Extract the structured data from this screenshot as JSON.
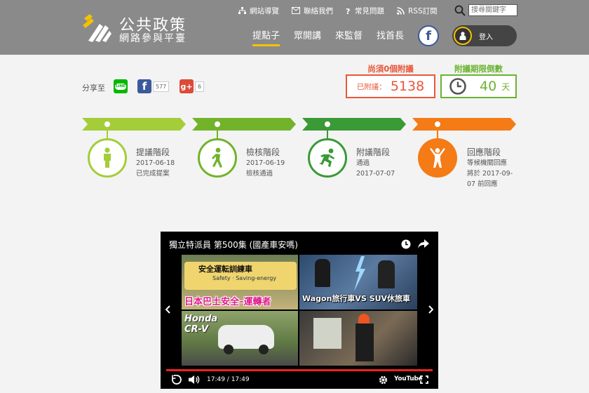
{
  "header": {
    "logo_title": "公共政策",
    "logo_sub": "網路參與平臺",
    "toplinks": [
      {
        "label": "網站導覽",
        "icon": "sitemap-icon"
      },
      {
        "label": "聯絡我們",
        "icon": "mail-icon"
      },
      {
        "label": "常見問題",
        "icon": "question-icon"
      },
      {
        "label": "RSS訂閱",
        "icon": "rss-icon"
      }
    ],
    "search_placeholder": "搜尋關鍵字",
    "nav": [
      {
        "label": "提點子",
        "active": true
      },
      {
        "label": "眾開講",
        "active": false
      },
      {
        "label": "來監督",
        "active": false
      },
      {
        "label": "找首長",
        "active": false
      }
    ],
    "facebook_glyph": "f",
    "login_label": "登入"
  },
  "share": {
    "label": "分享至",
    "line_text": "LINE",
    "facebook_glyph": "f",
    "facebook_count": "577",
    "gplus_glyph": "g+",
    "gplus_count": "6"
  },
  "counters": {
    "needed_title": "尚須0個附議",
    "signed_label": "已附議：",
    "signed_value": "5138",
    "deadline_title": "附議期限倒數",
    "days_value": "40",
    "days_unit": "天"
  },
  "timeline": [
    {
      "title": "提議階段",
      "lines": [
        "2017-06-18",
        "已完成提案"
      ],
      "color": "#a4cd39",
      "filled": false
    },
    {
      "title": "檢核階段",
      "lines": [
        "2017-06-19",
        "檢核通過"
      ],
      "color": "#72b32a",
      "filled": false
    },
    {
      "title": "附議階段",
      "lines": [
        "通過",
        "2017-07-07"
      ],
      "color": "#3a9a35",
      "filled": false
    },
    {
      "title": "回應階段",
      "lines": [
        "等候機關回應",
        "將於 2017-09-",
        "07 前回應"
      ],
      "color": "#f47b16",
      "filled": true
    }
  ],
  "video": {
    "title": "獨立特派員 第500集 (國產車安嗎)",
    "thumb1_text": "日本巴士安全–運轉者",
    "thumb1_banner": "安全運転訓練車",
    "thumb1_sub": "Safety · Saving-energy",
    "thumb2_text": "Wagon旅行車VS SUV休旅車",
    "thumb3_text": "Honda CR-V",
    "time": "17:49 / 17:49",
    "youtube_label": "YouTube"
  },
  "colors": {
    "header_bg": "#8a8a8a",
    "accent_yellow": "#f5c200",
    "counter_red": "#e8573a",
    "counter_green": "#6bb332",
    "facebook_blue": "#3b5a9b",
    "line_green": "#00b900",
    "gplus_red": "#dc4a38"
  }
}
